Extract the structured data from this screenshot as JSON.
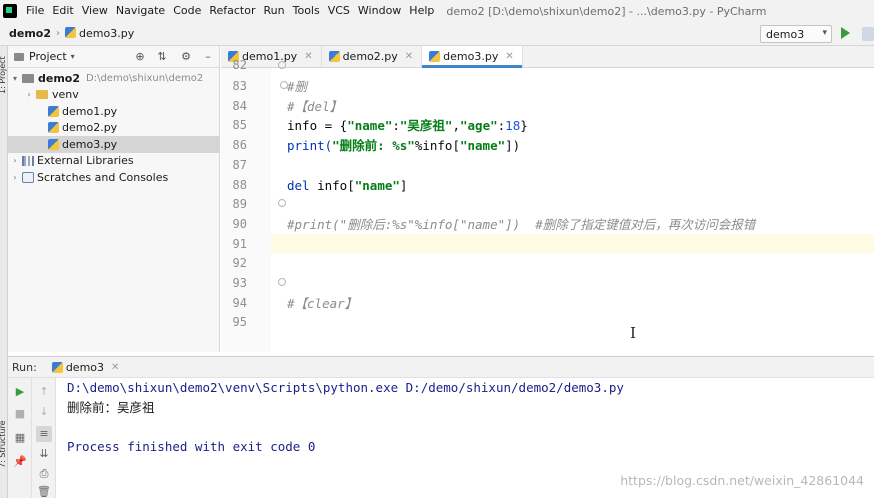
{
  "menubar": {
    "items": [
      "File",
      "Edit",
      "View",
      "Navigate",
      "Code",
      "Refactor",
      "Run",
      "Tools",
      "VCS",
      "Window",
      "Help"
    ],
    "window_title": "demo2 [D:\\demo\\shixun\\demo2] - ...\\demo3.py - PyCharm"
  },
  "navbar": {
    "project": "demo2",
    "file": "demo3.py",
    "run_config": "demo3"
  },
  "left_stripe": {
    "project_label": "1: Project",
    "structure_label": "7: Structure"
  },
  "project_panel": {
    "title": "Project",
    "tree": [
      {
        "label": "demo2",
        "hint": "D:\\demo\\shixun\\demo2",
        "type": "folder-root",
        "indent": 0,
        "toggle": "▾"
      },
      {
        "label": "venv",
        "hint": "",
        "type": "folder",
        "indent": 1,
        "toggle": "›"
      },
      {
        "label": "demo1.py",
        "hint": "",
        "type": "py",
        "indent": 2,
        "toggle": ""
      },
      {
        "label": "demo2.py",
        "hint": "",
        "type": "py",
        "indent": 2,
        "toggle": ""
      },
      {
        "label": "demo3.py",
        "hint": "",
        "type": "py",
        "indent": 2,
        "toggle": "",
        "selected": true
      },
      {
        "label": "External Libraries",
        "hint": "",
        "type": "lib",
        "indent": 0,
        "toggle": "›"
      },
      {
        "label": "Scratches and Consoles",
        "hint": "",
        "type": "scratch",
        "indent": 0,
        "toggle": "›"
      }
    ]
  },
  "editor": {
    "tabs": [
      {
        "label": "demo1.py",
        "active": false
      },
      {
        "label": "demo2.py",
        "active": false
      },
      {
        "label": "demo3.py",
        "active": true
      }
    ],
    "partial_line_number": "82",
    "lines": [
      {
        "n": "83",
        "parts": [
          {
            "t": "#删",
            "c": "c-comment"
          }
        ]
      },
      {
        "n": "84",
        "parts": [
          {
            "t": "#【del】",
            "c": "c-comment"
          }
        ]
      },
      {
        "n": "85",
        "parts": [
          {
            "t": "info = {",
            "c": "c-plain"
          },
          {
            "t": "\"name\"",
            "c": "c-str"
          },
          {
            "t": ":",
            "c": "c-plain"
          },
          {
            "t": "\"吴彦祖\"",
            "c": "c-str"
          },
          {
            "t": ",",
            "c": "c-plain"
          },
          {
            "t": "\"age\"",
            "c": "c-str"
          },
          {
            "t": ":",
            "c": "c-plain"
          },
          {
            "t": "18",
            "c": "c-num"
          },
          {
            "t": "}",
            "c": "c-plain"
          }
        ]
      },
      {
        "n": "86",
        "parts": [
          {
            "t": "print(",
            "c": "c-kw"
          },
          {
            "t": "\"删除前: %s\"",
            "c": "c-str"
          },
          {
            "t": "%info[",
            "c": "c-plain"
          },
          {
            "t": "\"name\"",
            "c": "c-str"
          },
          {
            "t": "])",
            "c": "c-plain"
          }
        ]
      },
      {
        "n": "87",
        "parts": []
      },
      {
        "n": "88",
        "parts": [
          {
            "t": "del ",
            "c": "c-kw"
          },
          {
            "t": "info[",
            "c": "c-plain"
          },
          {
            "t": "\"name\"",
            "c": "c-str"
          },
          {
            "t": "]",
            "c": "c-plain"
          }
        ]
      },
      {
        "n": "89",
        "parts": []
      },
      {
        "n": "90",
        "parts": [
          {
            "t": "#print(\"删除后:%s\"%info[\"name\"])  #删除了指定键值对后，再次访问会报错",
            "c": "c-comment"
          }
        ]
      },
      {
        "n": "91",
        "parts": []
      },
      {
        "n": "92",
        "parts": []
      },
      {
        "n": "93",
        "parts": []
      },
      {
        "n": "94",
        "parts": [
          {
            "t": "#【clear】",
            "c": "c-comment"
          }
        ]
      },
      {
        "n": "95",
        "parts": []
      }
    ]
  },
  "run_panel": {
    "label": "Run:",
    "tab": "demo3",
    "output": [
      {
        "text": "D:\\demo\\shixun\\demo2\\venv\\Scripts\\python.exe D:/demo/shixun/demo2/demo3.py",
        "kind": "out-cmd"
      },
      {
        "text": "删除前：吴彦祖",
        "kind": "out-text"
      },
      {
        "text": "",
        "kind": "out-text"
      },
      {
        "text": "Process finished with exit code 0",
        "kind": "out-cmd"
      }
    ]
  },
  "watermark": "https://blog.csdn.net/weixin_42861044",
  "colors": {
    "accent": "#4083c9",
    "string": "#067d17",
    "keyword": "#0033b3",
    "number": "#1750eb",
    "comment": "#8c8c8c",
    "run_green": "#3a9d3a"
  }
}
